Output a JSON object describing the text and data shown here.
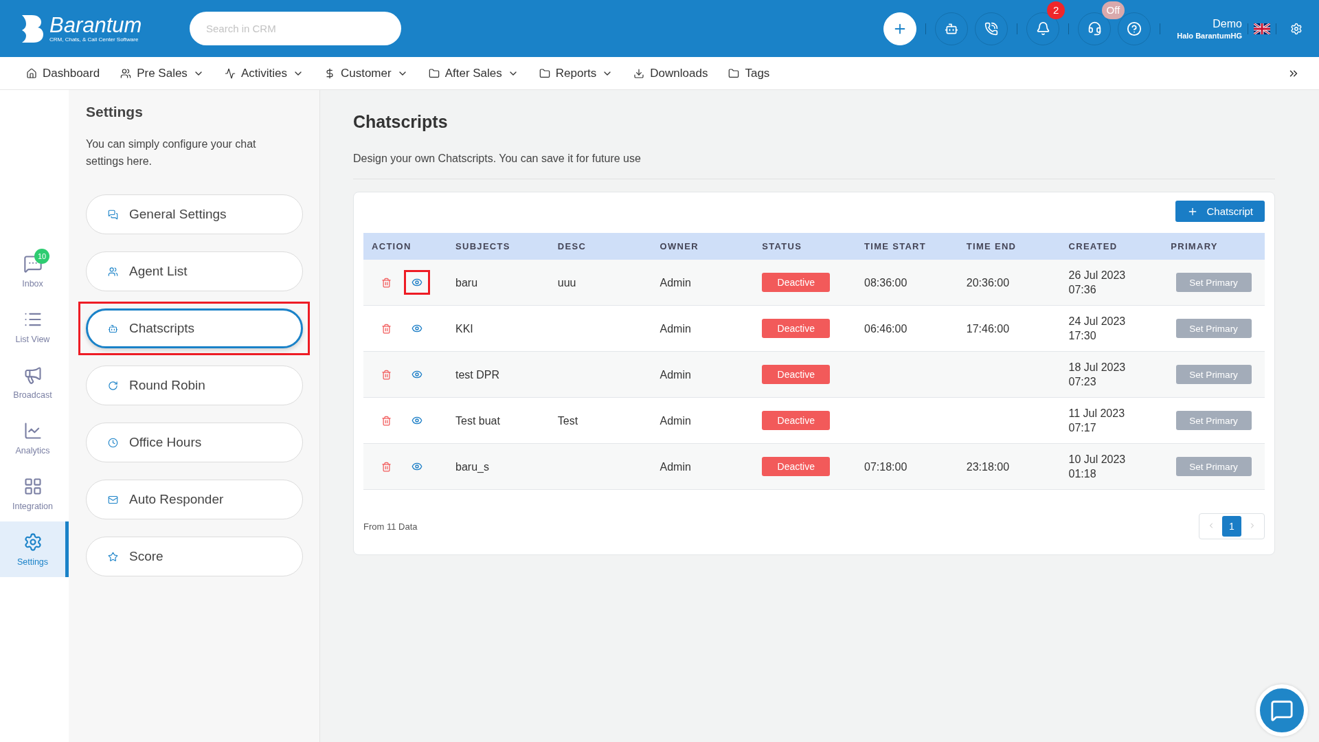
{
  "header": {
    "logo": {
      "name": "Barantum",
      "tagline": "CRM, Chats, & Call Center Software"
    },
    "search": {
      "placeholder": "Search in CRM"
    },
    "notification_count": "2",
    "agent_status": "Off",
    "user": {
      "name": "Demo",
      "org": "Halo BarantumHG"
    }
  },
  "nav": [
    {
      "label": "Dashboard",
      "dropdown": false
    },
    {
      "label": "Pre Sales",
      "dropdown": true
    },
    {
      "label": "Activities",
      "dropdown": true
    },
    {
      "label": "Customer",
      "dropdown": true
    },
    {
      "label": "After Sales",
      "dropdown": true
    },
    {
      "label": "Reports",
      "dropdown": true
    },
    {
      "label": "Downloads",
      "dropdown": false
    },
    {
      "label": "Tags",
      "dropdown": false
    }
  ],
  "rail": [
    {
      "label": "Inbox",
      "badge": "10",
      "selected": false
    },
    {
      "label": "List View",
      "selected": false
    },
    {
      "label": "Broadcast",
      "selected": false
    },
    {
      "label": "Analytics",
      "selected": false
    },
    {
      "label": "Integration",
      "selected": false
    },
    {
      "label": "Settings",
      "selected": true
    }
  ],
  "settings": {
    "title": "Settings",
    "description": "You can simply configure your chat settings here.",
    "items": [
      {
        "label": "General Settings",
        "selected": false,
        "highlighted": false
      },
      {
        "label": "Agent List",
        "selected": false,
        "highlighted": false
      },
      {
        "label": "Chatscripts",
        "selected": true,
        "highlighted": true
      },
      {
        "label": "Round Robin",
        "selected": false,
        "highlighted": false
      },
      {
        "label": "Office Hours",
        "selected": false,
        "highlighted": false
      },
      {
        "label": "Auto Responder",
        "selected": false,
        "highlighted": false
      },
      {
        "label": "Score",
        "selected": false,
        "highlighted": false
      }
    ]
  },
  "page": {
    "title": "Chatscripts",
    "description": "Design your own Chatscripts. You can save it for future use",
    "add_button": "Chatscript"
  },
  "table": {
    "columns": [
      "ACTION",
      "SUBJECTS",
      "DESC",
      "OWNER",
      "STATUS",
      "TIME START",
      "TIME END",
      "CREATED",
      "PRIMARY"
    ],
    "rows": [
      {
        "subject": "baru",
        "desc": "uuu",
        "owner": "Admin",
        "status": {
          "label": "Deactive",
          "active": false
        },
        "time_start": "08:36:00",
        "time_end": "20:36:00",
        "created": "26 Jul 2023 07:36",
        "primary": {
          "label": "Set Primary",
          "on": false
        },
        "view_highlighted": true
      },
      {
        "subject": "KKI",
        "owner": "Admin",
        "status": {
          "label": "Deactive",
          "active": false
        },
        "time_start": "06:46:00",
        "time_end": "17:46:00",
        "created": "24 Jul 2023 17:30",
        "primary": {
          "label": "Set Primary",
          "on": false
        },
        "view_highlighted": false
      },
      {
        "subject": "test DPR",
        "owner": "Admin",
        "status": {
          "label": "Deactive",
          "active": false
        },
        "created": "18 Jul 2023 07:23",
        "primary": {
          "label": "Set Primary",
          "on": false
        },
        "view_highlighted": false
      },
      {
        "subject": "Test buat",
        "desc": "Test",
        "owner": "Admin",
        "status": {
          "label": "Deactive",
          "active": false
        },
        "created": "11 Jul 2023 07:17",
        "primary": {
          "label": "Set Primary",
          "on": false
        },
        "view_highlighted": false
      },
      {
        "subject": "baru_s",
        "owner": "Admin",
        "status": {
          "label": "Deactive",
          "active": false
        },
        "time_start": "07:18:00",
        "time_end": "23:18:00",
        "created": "10 Jul 2023 01:18",
        "primary": {
          "label": "Set Primary",
          "on": false
        },
        "view_highlighted": false
      }
    ],
    "footer": "From 11 Data",
    "pages": [
      {
        "label": "1",
        "selected": true
      }
    ]
  }
}
